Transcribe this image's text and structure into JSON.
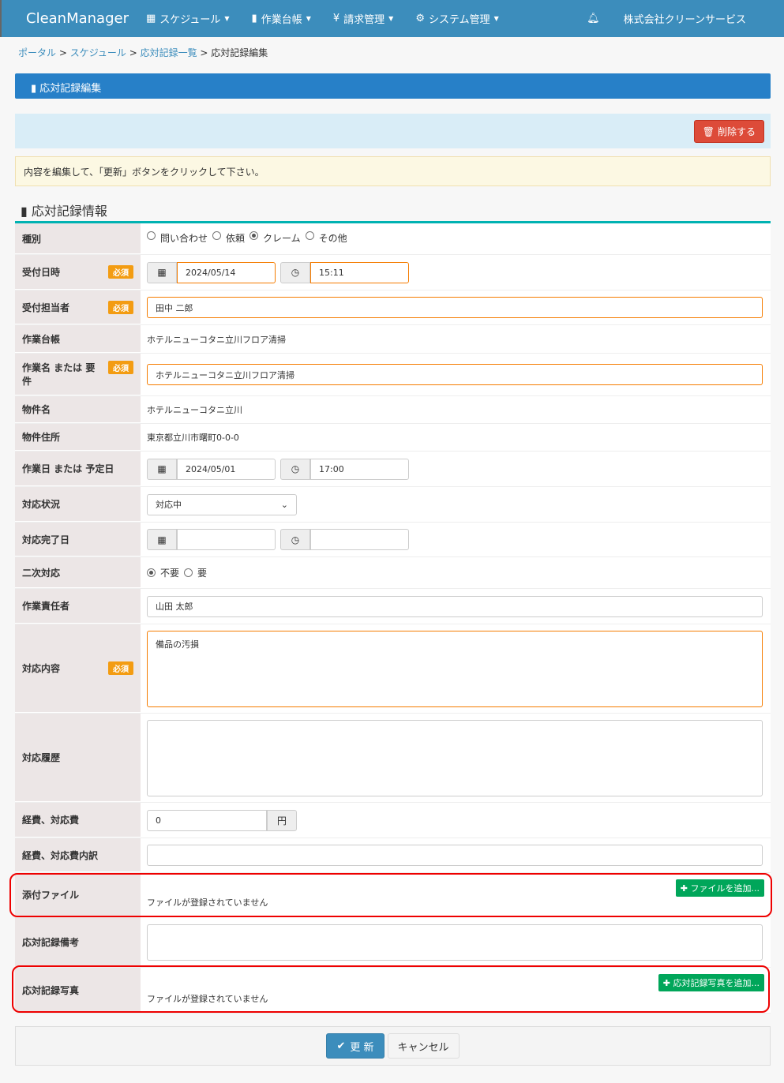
{
  "nav": {
    "brand": "CleanManager",
    "menus": [
      "スケジュール",
      "作業台帳",
      "請求管理",
      "システム管理"
    ],
    "company": "株式会社クリーンサービス"
  },
  "breadcrumb": [
    "ポータル",
    "スケジュール",
    "応対記録一覧",
    "応対記録編集"
  ],
  "page_title": "応対記録編集",
  "delete_label": "削除する",
  "notice": "内容を編集して、「更新」ボタンをクリックして下さい。",
  "section_title": "応対記録情報",
  "required": "必須",
  "fields": {
    "type": {
      "label": "種別",
      "options": [
        "問い合わせ",
        "依頼",
        "クレーム",
        "その他"
      ],
      "selected": "クレーム"
    },
    "received": {
      "label": "受付日時",
      "date": "2024/05/14",
      "time": "15:11"
    },
    "receiver": {
      "label": "受付担当者",
      "value": "田中 二郎"
    },
    "ledger": {
      "label": "作業台帳",
      "value": "ホテルニューコタニ立川フロア清掃"
    },
    "work_name": {
      "label": "作業名 または 要件",
      "value": "ホテルニューコタニ立川フロア清掃"
    },
    "property": {
      "label": "物件名",
      "value": "ホテルニューコタニ立川"
    },
    "address": {
      "label": "物件住所",
      "value": "東京都立川市曙町0-0-0"
    },
    "work_date": {
      "label": "作業日 または 予定日",
      "date": "2024/05/01",
      "time": "17:00"
    },
    "status": {
      "label": "対応状況",
      "value": "対応中"
    },
    "done_date": {
      "label": "対応完了日",
      "date": "",
      "time": ""
    },
    "secondary": {
      "label": "二次対応",
      "options": [
        "不要",
        "要"
      ],
      "selected": "不要"
    },
    "manager": {
      "label": "作業責任者",
      "value": "山田 太郎"
    },
    "content": {
      "label": "対応内容",
      "value": "備品の汚損"
    },
    "history": {
      "label": "対応履歴",
      "value": ""
    },
    "cost": {
      "label": "経費、対応費",
      "value": "0",
      "unit": "円"
    },
    "cost_detail": {
      "label": "経費、対応費内訳",
      "value": ""
    },
    "attachment": {
      "label": "添付ファイル",
      "button": "ファイルを追加...",
      "empty": "ファイルが登録されていません"
    },
    "remarks": {
      "label": "応対記録備考",
      "value": ""
    },
    "photo": {
      "label": "応対記録写真",
      "button": "応対記録写真を追加...",
      "empty": "ファイルが登録されていません"
    }
  },
  "buttons": {
    "update": "更 新",
    "cancel": "キャンセル"
  }
}
